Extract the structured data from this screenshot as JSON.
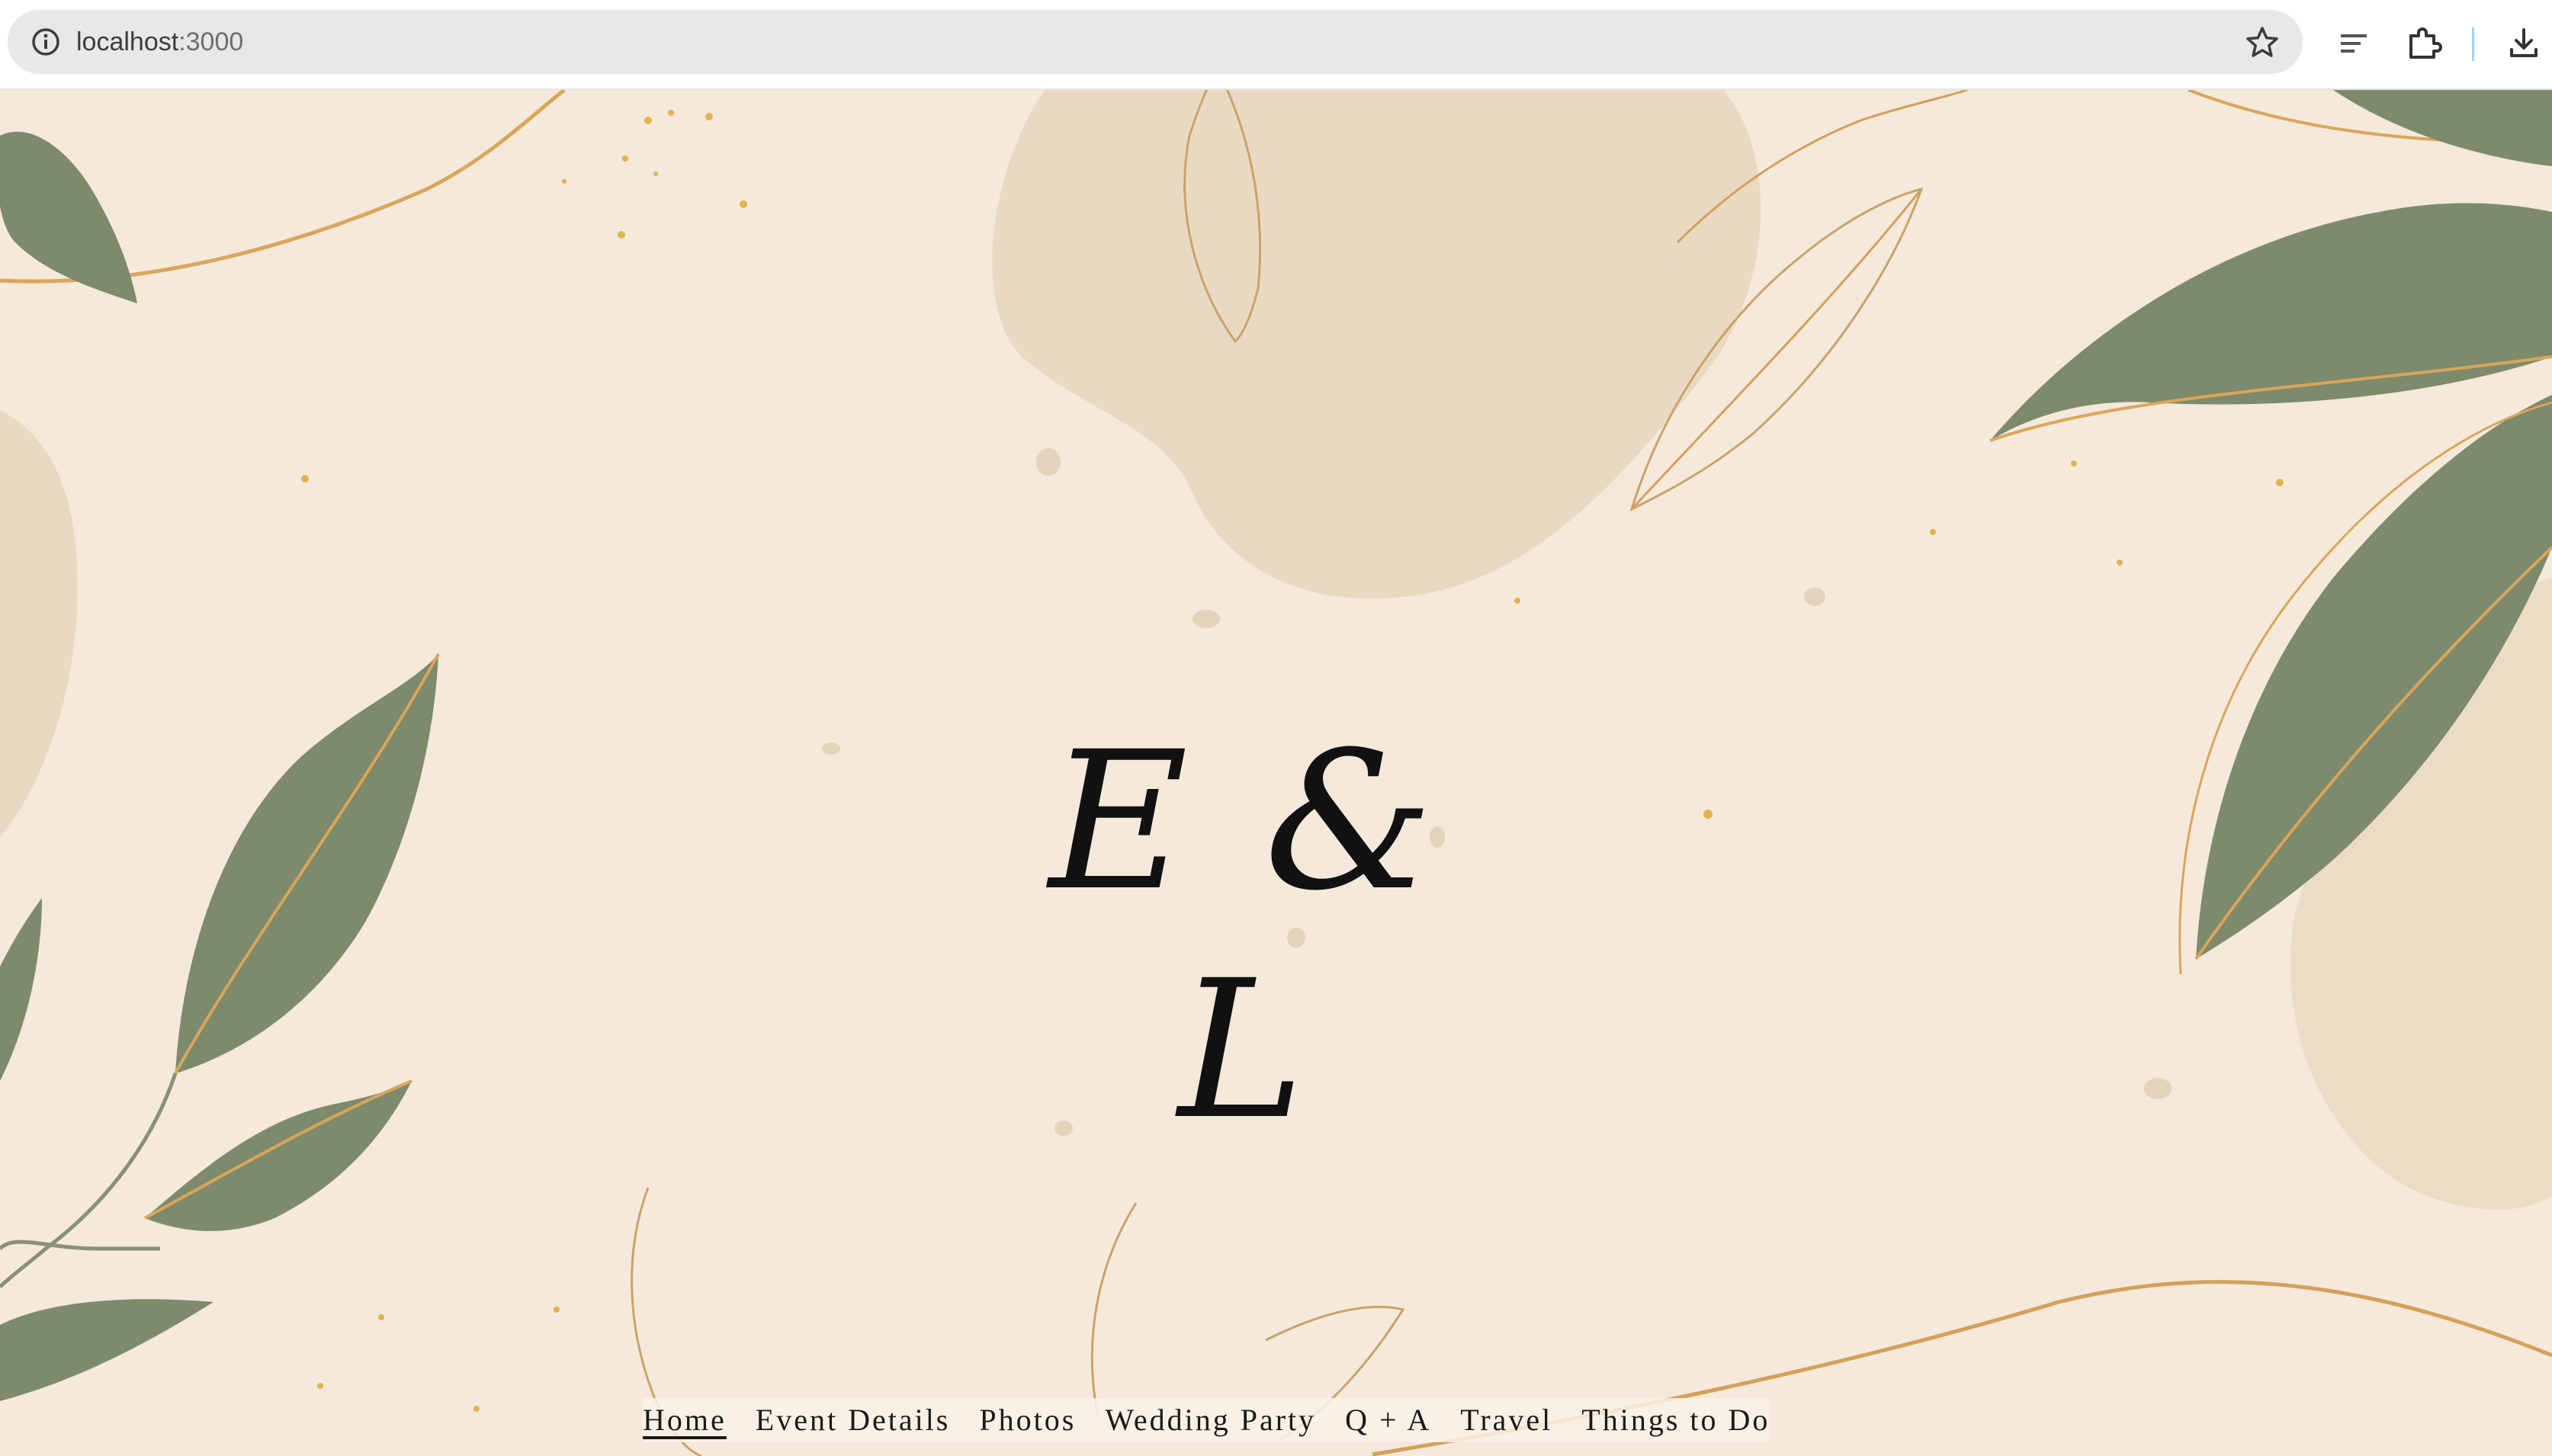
{
  "browser": {
    "url_host": "localhost",
    "url_port": ":3000"
  },
  "icons": {
    "site_info": "info-icon",
    "bookmark": "star-icon",
    "tab_search": "tab-search-icon",
    "extensions": "puzzle-icon",
    "downloads": "download-icon"
  },
  "colors": {
    "background": "#f4e9db",
    "leaf_green": "#7e8a6c",
    "gold": "#d9a65a",
    "text": "#111111"
  },
  "hero": {
    "monogram": "E & L"
  },
  "nav": {
    "items": [
      {
        "label": "Home",
        "active": true
      },
      {
        "label": "Event Details",
        "active": false
      },
      {
        "label": "Photos",
        "active": false
      },
      {
        "label": "Wedding Party",
        "active": false
      },
      {
        "label": "Q + A",
        "active": false
      },
      {
        "label": "Travel",
        "active": false
      },
      {
        "label": "Things to Do",
        "active": false
      }
    ]
  }
}
